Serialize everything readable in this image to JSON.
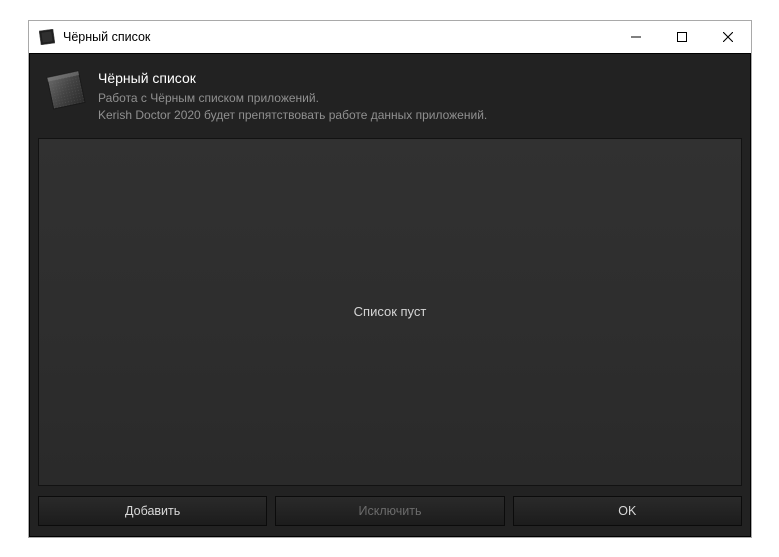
{
  "titlebar": {
    "title": "Чёрный список"
  },
  "header": {
    "title": "Чёрный список",
    "desc_line1": "Работа с Чёрным списком приложений.",
    "desc_line2": "Kerish Doctor 2020 будет препятствовать работе данных приложений."
  },
  "list": {
    "empty_text": "Список пуст"
  },
  "buttons": {
    "add": "Добавить",
    "exclude": "Исключить",
    "ok": "OK"
  }
}
